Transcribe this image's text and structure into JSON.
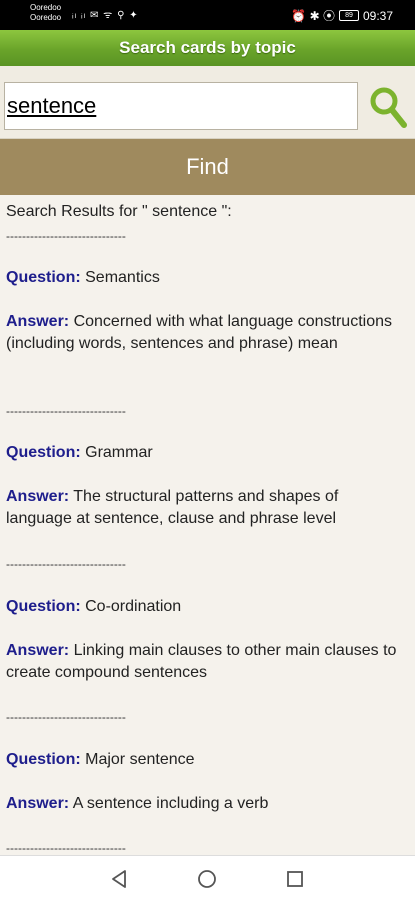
{
  "status": {
    "carrier1": "Ooredoo",
    "carrier2": "Ooredoo",
    "left_icons": "ᵢₗ ᵢₗ ✉ ᯤ ⚲ ✦",
    "right_icons": "⏰ ✱ ⦿",
    "battery": "89",
    "time": "09:37"
  },
  "header": {
    "title": "Search cards by topic"
  },
  "search": {
    "value": "sentence",
    "icon": "search-icon"
  },
  "find_button": {
    "label": "Find"
  },
  "results": {
    "heading": "Search Results for \" sentence \":",
    "separator": "------------------------------",
    "question_label": "Question:",
    "answer_label": "Answer:",
    "items": [
      {
        "question": "Semantics",
        "answer": "Concerned with what language constructions (including words, sentences and phrase) mean"
      },
      {
        "question": "Grammar",
        "answer": "The structural patterns and shapes of language at sentence, clause and phrase level"
      },
      {
        "question": "Co-ordination",
        "answer": "Linking main clauses to other main clauses to create compound sentences"
      },
      {
        "question": "Major sentence",
        "answer": "A sentence including a verb"
      }
    ]
  },
  "navbar": {
    "icons": [
      "back-icon",
      "home-icon",
      "recents-icon"
    ]
  },
  "colors": {
    "title_green": "#6aa42a",
    "find_bar": "#9f8a5e",
    "label_blue": "#1e1e8c"
  }
}
